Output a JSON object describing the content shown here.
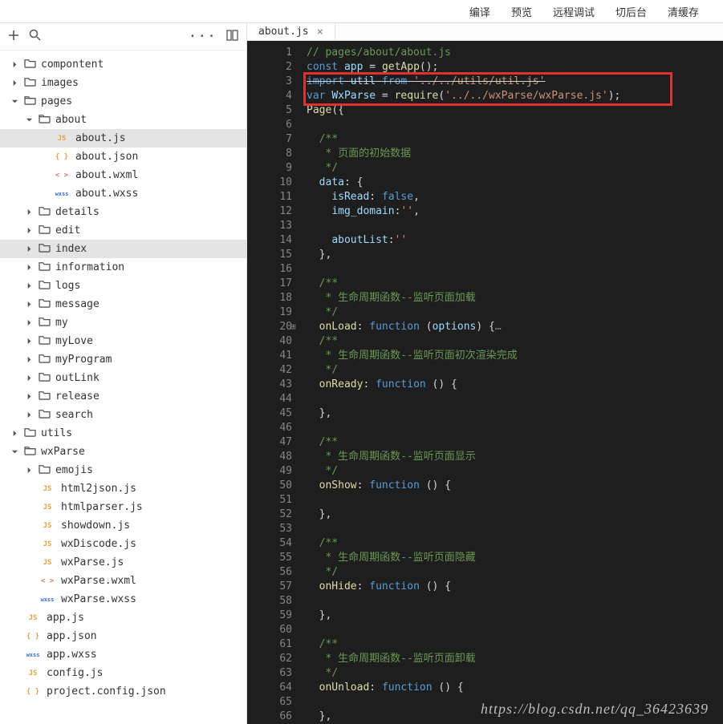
{
  "topmenu": [
    "编译",
    "预览",
    "远程调试",
    "切后台",
    "清缓存"
  ],
  "tab": {
    "label": "about.js"
  },
  "watermark": "https://blog.csdn.net/qq_36423639",
  "tree": [
    {
      "depth": 0,
      "type": "folder",
      "state": "closed",
      "name": "compontent"
    },
    {
      "depth": 0,
      "type": "folder",
      "state": "closed",
      "name": "images"
    },
    {
      "depth": 0,
      "type": "folder",
      "state": "open",
      "name": "pages"
    },
    {
      "depth": 1,
      "type": "folder",
      "state": "open",
      "name": "about"
    },
    {
      "depth": 2,
      "type": "file",
      "icon": "js",
      "name": "about.js",
      "selected": true
    },
    {
      "depth": 2,
      "type": "file",
      "icon": "json",
      "name": "about.json"
    },
    {
      "depth": 2,
      "type": "file",
      "icon": "wxml",
      "name": "about.wxml"
    },
    {
      "depth": 2,
      "type": "file",
      "icon": "wxss",
      "name": "about.wxss"
    },
    {
      "depth": 1,
      "type": "folder",
      "state": "closed",
      "name": "details"
    },
    {
      "depth": 1,
      "type": "folder",
      "state": "closed",
      "name": "edit"
    },
    {
      "depth": 1,
      "type": "folder",
      "state": "closed",
      "name": "index",
      "selected": true
    },
    {
      "depth": 1,
      "type": "folder",
      "state": "closed",
      "name": "information"
    },
    {
      "depth": 1,
      "type": "folder",
      "state": "closed",
      "name": "logs"
    },
    {
      "depth": 1,
      "type": "folder",
      "state": "closed",
      "name": "message"
    },
    {
      "depth": 1,
      "type": "folder",
      "state": "closed",
      "name": "my"
    },
    {
      "depth": 1,
      "type": "folder",
      "state": "closed",
      "name": "myLove"
    },
    {
      "depth": 1,
      "type": "folder",
      "state": "closed",
      "name": "myProgram"
    },
    {
      "depth": 1,
      "type": "folder",
      "state": "closed",
      "name": "outLink"
    },
    {
      "depth": 1,
      "type": "folder",
      "state": "closed",
      "name": "release"
    },
    {
      "depth": 1,
      "type": "folder",
      "state": "closed",
      "name": "search"
    },
    {
      "depth": 0,
      "type": "folder",
      "state": "closed",
      "name": "utils"
    },
    {
      "depth": 0,
      "type": "folder",
      "state": "open",
      "name": "wxParse"
    },
    {
      "depth": 1,
      "type": "folder",
      "state": "closed",
      "name": "emojis"
    },
    {
      "depth": 1,
      "type": "file",
      "icon": "js",
      "name": "html2json.js"
    },
    {
      "depth": 1,
      "type": "file",
      "icon": "js",
      "name": "htmlparser.js"
    },
    {
      "depth": 1,
      "type": "file",
      "icon": "js",
      "name": "showdown.js"
    },
    {
      "depth": 1,
      "type": "file",
      "icon": "js",
      "name": "wxDiscode.js"
    },
    {
      "depth": 1,
      "type": "file",
      "icon": "js",
      "name": "wxParse.js"
    },
    {
      "depth": 1,
      "type": "file",
      "icon": "wxml",
      "name": "wxParse.wxml"
    },
    {
      "depth": 1,
      "type": "file",
      "icon": "wxss",
      "name": "wxParse.wxss"
    },
    {
      "depth": 0,
      "type": "file",
      "icon": "js",
      "name": "app.js"
    },
    {
      "depth": 0,
      "type": "file",
      "icon": "json",
      "name": "app.json"
    },
    {
      "depth": 0,
      "type": "file",
      "icon": "wxss",
      "name": "app.wxss"
    },
    {
      "depth": 0,
      "type": "file",
      "icon": "js",
      "name": "config.js"
    },
    {
      "depth": 0,
      "type": "file",
      "icon": "json",
      "name": "project.config.json"
    }
  ],
  "code": {
    "lines": [
      {
        "n": 1,
        "html": "<span class='c-comment'>// pages/about/about.js</span>"
      },
      {
        "n": 2,
        "html": "<span class='c-kw'>const</span> <span class='c-var'>app</span> = <span class='c-fn'>getApp</span>();"
      },
      {
        "n": 3,
        "html": "<span class='strike'><span class='c-kw'>import</span> <span class='c-var'>util</span> <span class='c-kw'>from</span> <span class='c-str'>'../../utils/util.js'</span></span>"
      },
      {
        "n": 4,
        "html": "<span class='c-kw'>var</span> <span class='c-var'>WxParse</span> = <span class='c-fn'>require</span>(<span class='c-str'>'../../wxParse/wxParse.js'</span>);"
      },
      {
        "n": 5,
        "html": "<span class='c-fn'>Page</span>({"
      },
      {
        "n": 6,
        "html": ""
      },
      {
        "n": 7,
        "html": "  <span class='c-comment'>/**</span>"
      },
      {
        "n": 8,
        "html": "<span class='c-comment'>   * 页面的初始数据</span>"
      },
      {
        "n": 9,
        "html": "<span class='c-comment'>   */</span>"
      },
      {
        "n": 10,
        "html": "  <span class='c-prop'>data</span>: {"
      },
      {
        "n": 11,
        "html": "    <span class='c-prop'>isRead</span>: <span class='c-num'>false</span>,"
      },
      {
        "n": 12,
        "html": "    <span class='c-prop'>img_domain</span>:<span class='c-str'>''</span>,"
      },
      {
        "n": 13,
        "html": ""
      },
      {
        "n": 14,
        "html": "    <span class='c-prop'>aboutList</span>:<span class='c-str'>''</span>"
      },
      {
        "n": 15,
        "html": "  },"
      },
      {
        "n": 16,
        "html": ""
      },
      {
        "n": 17,
        "html": "  <span class='c-comment'>/**</span>"
      },
      {
        "n": 18,
        "html": "<span class='c-comment'>   * 生命周期函数--监听页面加载</span>"
      },
      {
        "n": 19,
        "html": "<span class='c-comment'>   */</span>"
      },
      {
        "n": 20,
        "html": "  <span class='c-fn'>onLoad</span>: <span class='c-kw'>function</span> (<span class='c-var'>options</span>) {<span style='color:#858585'>…</span>",
        "fold": true
      },
      {
        "n": 40,
        "html": "  <span class='c-comment'>/**</span>"
      },
      {
        "n": 41,
        "html": "<span class='c-comment'>   * 生命周期函数--监听页面初次渲染完成</span>"
      },
      {
        "n": 42,
        "html": "<span class='c-comment'>   */</span>"
      },
      {
        "n": 43,
        "html": "  <span class='c-fn'>onReady</span>: <span class='c-kw'>function</span> () {"
      },
      {
        "n": 44,
        "html": ""
      },
      {
        "n": 45,
        "html": "  },"
      },
      {
        "n": 46,
        "html": ""
      },
      {
        "n": 47,
        "html": "  <span class='c-comment'>/**</span>"
      },
      {
        "n": 48,
        "html": "<span class='c-comment'>   * 生命周期函数--监听页面显示</span>"
      },
      {
        "n": 49,
        "html": "<span class='c-comment'>   */</span>"
      },
      {
        "n": 50,
        "html": "  <span class='c-fn'>onShow</span>: <span class='c-kw'>function</span> () {"
      },
      {
        "n": 51,
        "html": ""
      },
      {
        "n": 52,
        "html": "  },"
      },
      {
        "n": 53,
        "html": ""
      },
      {
        "n": 54,
        "html": "  <span class='c-comment'>/**</span>"
      },
      {
        "n": 55,
        "html": "<span class='c-comment'>   * 生命周期函数--监听页面隐藏</span>"
      },
      {
        "n": 56,
        "html": "<span class='c-comment'>   */</span>"
      },
      {
        "n": 57,
        "html": "  <span class='c-fn'>onHide</span>: <span class='c-kw'>function</span> () {"
      },
      {
        "n": 58,
        "html": ""
      },
      {
        "n": 59,
        "html": "  },"
      },
      {
        "n": 60,
        "html": ""
      },
      {
        "n": 61,
        "html": "  <span class='c-comment'>/**</span>"
      },
      {
        "n": 62,
        "html": "<span class='c-comment'>   * 生命周期函数--监听页面卸载</span>"
      },
      {
        "n": 63,
        "html": "<span class='c-comment'>   */</span>"
      },
      {
        "n": 64,
        "html": "  <span class='c-fn'>onUnload</span>: <span class='c-kw'>function</span> () {"
      },
      {
        "n": 65,
        "html": ""
      },
      {
        "n": 66,
        "html": "  },"
      }
    ],
    "highlight": {
      "line_from": 3,
      "line_to": 4
    }
  }
}
